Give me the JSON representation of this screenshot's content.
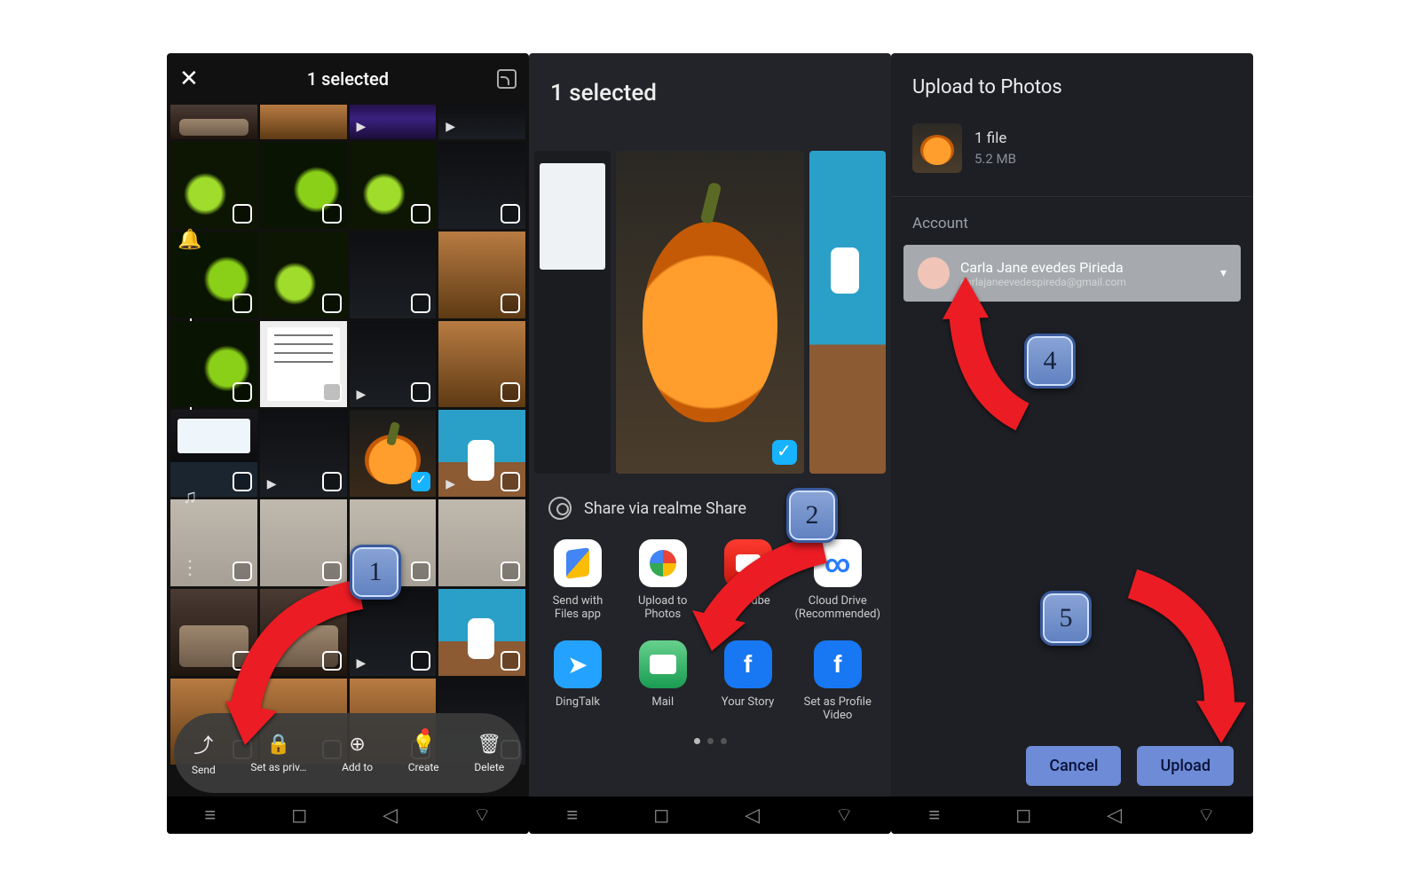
{
  "phone1": {
    "title": "1 selected",
    "actions": {
      "send": "Send",
      "private": "Set as priv…",
      "addto": "Add to",
      "create": "Create",
      "delete": "Delete"
    }
  },
  "phone2": {
    "title": "1 selected",
    "shareLabel": "Share via realme Share",
    "apps": {
      "files": "Send with Files app",
      "photos": "Upload to Photos",
      "youtube": "YouTube",
      "cloud": "Cloud Drive (Recommended)",
      "ding": "DingTalk",
      "mail": "Mail",
      "story": "Your Story",
      "profile": "Set as Profile Video"
    }
  },
  "phone3": {
    "title": "Upload to Photos",
    "fileCount": "1 file",
    "fileSize": "5.2 MB",
    "accountLabel": "Account",
    "accountName": "Carla Jane evedes Pirieda",
    "accountEmail": "carlajaneevedespireda@gmail.com",
    "cancel": "Cancel",
    "upload": "Upload"
  },
  "steps": {
    "s1": "1",
    "s2": "2",
    "s4": "4",
    "s5": "5"
  }
}
